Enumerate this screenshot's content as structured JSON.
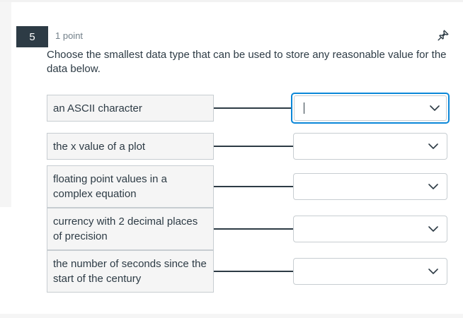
{
  "question": {
    "number": "5",
    "points": "1 point",
    "text": "Choose the smallest data type that can be used to store any reasonable value for the data below."
  },
  "matches": [
    {
      "prompt": "an ASCII character",
      "selected": ""
    },
    {
      "prompt": "the x value of a plot",
      "selected": ""
    },
    {
      "prompt": "floating point values in a complex equation",
      "selected": ""
    },
    {
      "prompt": "currency with 2 decimal places of precision",
      "selected": ""
    },
    {
      "prompt": "the number of seconds since the start of the century",
      "selected": ""
    }
  ],
  "colors": {
    "badge": "#2d3b45",
    "focus": "#0b87d8",
    "text": "#2d3b45",
    "muted": "#73808a"
  },
  "icons": {
    "pin": "pushpin-icon",
    "dropdown": "chevron-down-icon"
  }
}
